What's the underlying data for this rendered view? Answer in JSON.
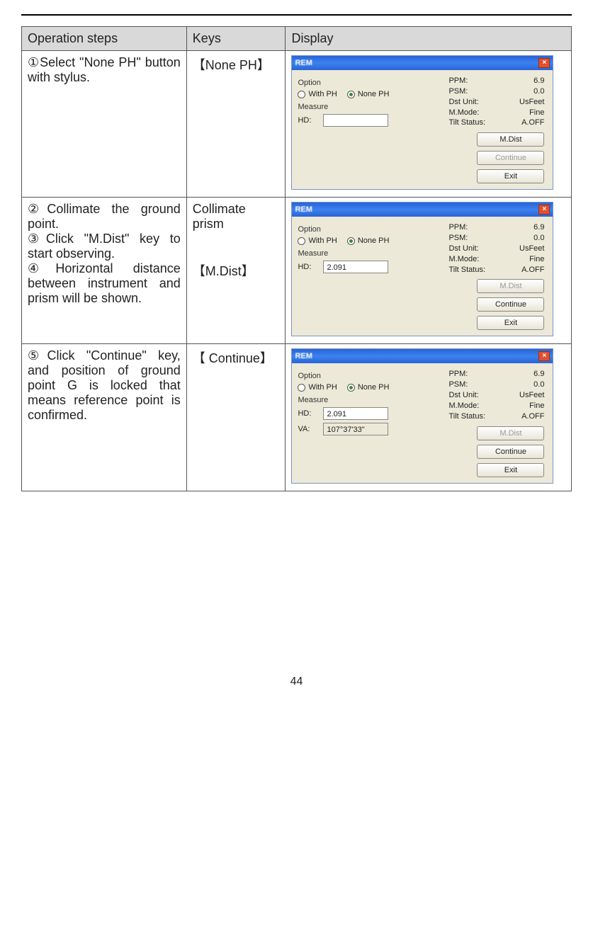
{
  "headers": {
    "c1": "Operation steps",
    "c2": "Keys",
    "c3": "Display"
  },
  "rows": [
    {
      "step_html": "①Select \"None PH\" button with stylus.",
      "keys": [
        "【None PH】"
      ],
      "win": {
        "title": "REM",
        "with_ph": "With PH",
        "none_ph": "None PH",
        "none_selected": true,
        "option": "Option",
        "measure": "Measure",
        "fields": [
          {
            "lbl": "HD:",
            "val": "",
            "ro": false
          }
        ],
        "stats": {
          "ppm": "6.9",
          "psm": "0.0",
          "dstunit": "UsFeet",
          "mmode": "Fine",
          "tilt": "A.OFF"
        },
        "btns": [
          {
            "t": "M.Dist",
            "d": false
          },
          {
            "t": "Continue",
            "d": true
          },
          {
            "t": "Exit",
            "d": false
          }
        ]
      }
    },
    {
      "step_html": "②Collimate the ground point.\n③Click \"M.Dist\" key to start  observing.\n④Horizontal distance between instrument and prism will be shown.",
      "keys": [
        "Collimate  prism",
        "",
        "【M.Dist】"
      ],
      "win": {
        "title": "REM",
        "with_ph": "With PH",
        "none_ph": "None PH",
        "none_selected": true,
        "option": "Option",
        "measure": "Measure",
        "fields": [
          {
            "lbl": "HD:",
            "val": "2.091",
            "ro": false
          }
        ],
        "stats": {
          "ppm": "6.9",
          "psm": "0.0",
          "dstunit": "UsFeet",
          "mmode": "Fine",
          "tilt": "A.OFF"
        },
        "btns": [
          {
            "t": "M.Dist",
            "d": true
          },
          {
            "t": "Continue",
            "d": false
          },
          {
            "t": "Exit",
            "d": false
          }
        ]
      }
    },
    {
      "step_html": "⑤Click \"Continue\" key, and position of ground point G is locked that means reference point is confirmed.",
      "keys": [
        "【 Continue】"
      ],
      "win": {
        "title": "REM",
        "with_ph": "With PH",
        "none_ph": "None PH",
        "none_selected": true,
        "option": "Option",
        "measure": "Measure",
        "fields": [
          {
            "lbl": "HD:",
            "val": "2.091",
            "ro": false
          },
          {
            "lbl": "VA:",
            "val": "107°37'33\"",
            "ro": true
          }
        ],
        "stats": {
          "ppm": "6.9",
          "psm": "0.0",
          "dstunit": "UsFeet",
          "mmode": "Fine",
          "tilt": "A.OFF"
        },
        "btns": [
          {
            "t": "M.Dist",
            "d": true
          },
          {
            "t": "Continue",
            "d": false
          },
          {
            "t": "Exit",
            "d": false
          }
        ]
      }
    }
  ],
  "stat_labels": {
    "ppm": "PPM:",
    "psm": "PSM:",
    "dstunit": "Dst Unit:",
    "mmode": "M.Mode:",
    "tilt": "Tilt Status:"
  },
  "page": "44"
}
